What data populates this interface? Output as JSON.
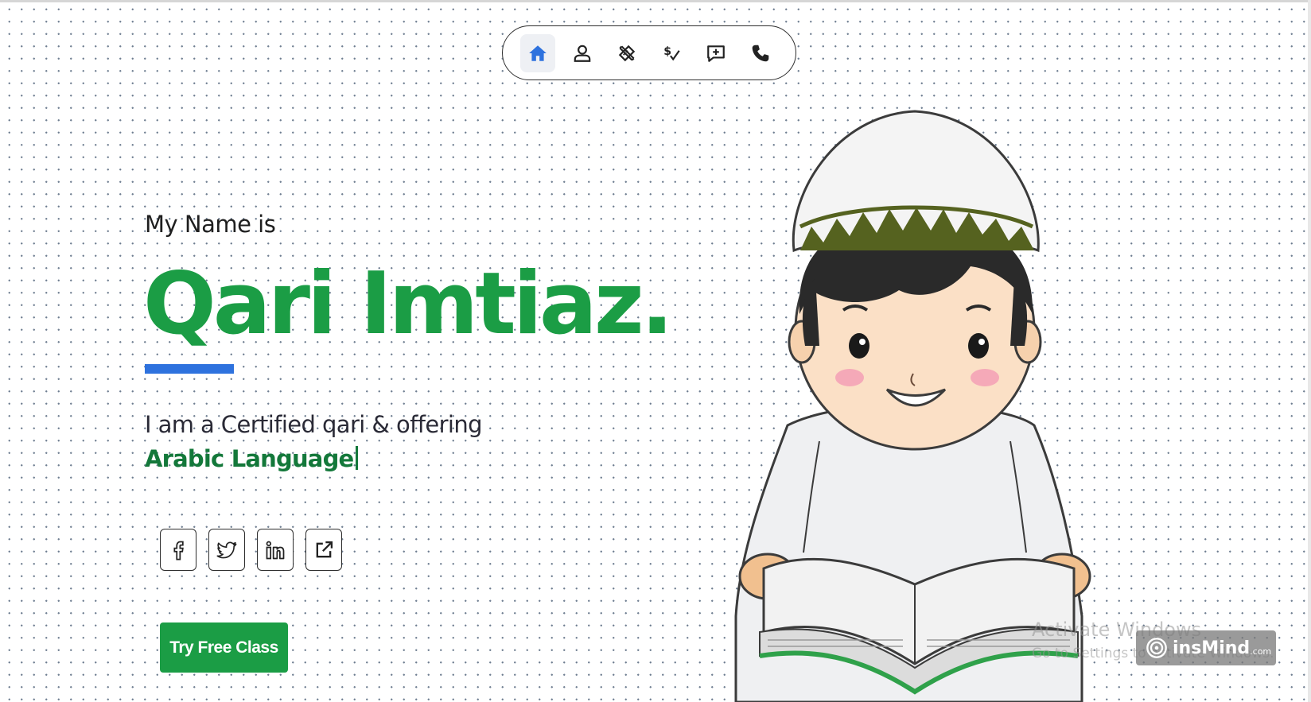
{
  "nav": {
    "items": [
      {
        "icon": "home-icon",
        "active": true
      },
      {
        "icon": "user-icon",
        "active": false
      },
      {
        "icon": "tools-icon",
        "active": false
      },
      {
        "icon": "pricing-icon",
        "active": false
      },
      {
        "icon": "message-plus-icon",
        "active": false
      },
      {
        "icon": "phone-icon",
        "active": false
      }
    ],
    "active_color": "#2e72de"
  },
  "hero": {
    "intro": "My Name is",
    "name": "Qari Imtiaz.",
    "tagline": "I am a Certified qari & offering",
    "typed_text": "Arabic Language",
    "cta_label": "Try Free Class",
    "accent_color": "#1b9d45",
    "underline_color": "#2e72de"
  },
  "social": [
    {
      "icon": "facebook-icon"
    },
    {
      "icon": "twitter-icon"
    },
    {
      "icon": "linkedin-icon"
    },
    {
      "icon": "external-link-icon"
    }
  ],
  "overlay": {
    "activate_title": "Activate Windows",
    "activate_sub": "Go to Settings to activate Windows.",
    "brand": "insMind",
    "brand_suffix": ".com"
  }
}
